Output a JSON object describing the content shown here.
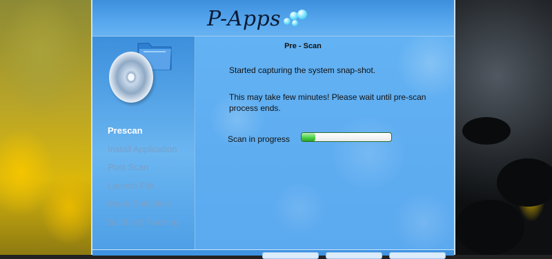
{
  "app": {
    "logo_text": "P-Apps"
  },
  "sidebar": {
    "steps": [
      {
        "label": "Prescan",
        "active": true
      },
      {
        "label": "Install Application",
        "active": false
      },
      {
        "label": "Post Scan",
        "active": false
      },
      {
        "label": "Launch File",
        "active": false
      },
      {
        "label": "Mode Selection",
        "active": false
      },
      {
        "label": "Build (or) Packing",
        "active": false
      }
    ]
  },
  "content": {
    "title": "Pre - Scan",
    "message1": "Started capturing the system snap-shot.",
    "message2": "This may take few minutes! Please wait until pre-scan process ends.",
    "scan_label": "Scan in progress",
    "progress_fraction": 0.15
  },
  "colors": {
    "window_blue": "#5aa8ec",
    "active_step": "#ffffff",
    "inactive_step": "#78a0c8",
    "progress_green": "#4fd24a"
  },
  "icons": [
    "disc-icon",
    "folder-icon",
    "bubbles-logo-icon"
  ]
}
